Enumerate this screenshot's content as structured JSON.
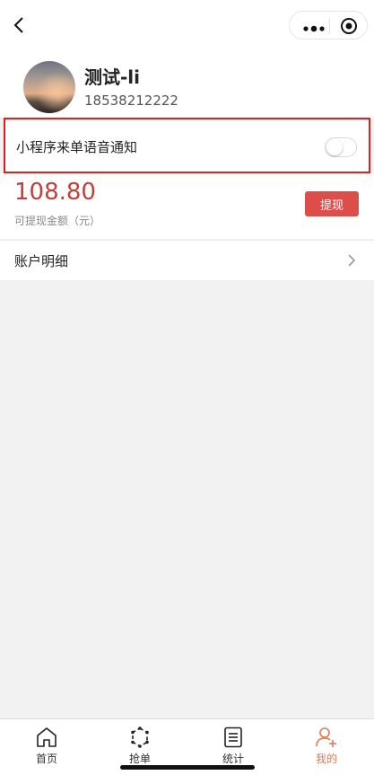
{
  "user": {
    "name": "测试-li",
    "phone": "18538212222"
  },
  "notify": {
    "label": "小程序来单语音通知",
    "enabled": false
  },
  "balance": {
    "amount": "108.80",
    "label": "可提现金额（元）",
    "withdraw_label": "提现"
  },
  "account": {
    "label": "账户明细"
  },
  "tabs": [
    {
      "label": "首页",
      "icon": "home-icon"
    },
    {
      "label": "抢单",
      "icon": "grab-order-icon"
    },
    {
      "label": "统计",
      "icon": "statistics-icon"
    },
    {
      "label": "我的",
      "icon": "profile-icon",
      "active": true
    }
  ],
  "colors": {
    "accent": "#c0413c",
    "button": "#dd4e4a",
    "active_tab": "#e07a54",
    "highlight_box": "#e02020"
  }
}
